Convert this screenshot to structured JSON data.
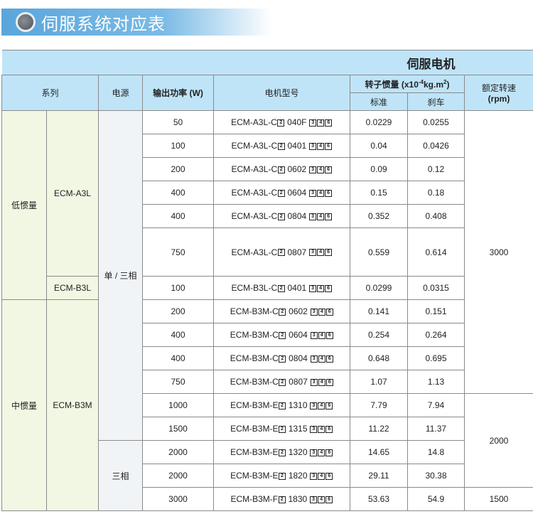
{
  "banner": {
    "title": "伺服系统对应表"
  },
  "header": {
    "group": "伺服电机",
    "series": "系列",
    "power_source": "电源",
    "output": "输出功率 (W)",
    "model": "电机型号",
    "inertia": "转子惯量 (x10",
    "inertia_exp": "-4",
    "inertia_unit": "kg.m",
    "inertia_sq": "2",
    "inertia_close": ")",
    "standard": "标准",
    "brake": "刹车",
    "speed": "额定转速",
    "speed_unit": "(rpm)"
  },
  "groups": {
    "low": "低惯量",
    "mid": "中惯量",
    "a3l": "ECM-A3L",
    "b3l": "ECM-B3L",
    "b3m": "ECM-B3M",
    "single_three": "单 / 三相",
    "three": "三相",
    "s3000": "3000",
    "s2000": "2000",
    "s1500": "1500"
  },
  "rows": [
    {
      "w": "50",
      "pre": "ECM-A3L-C",
      "b1": "2",
      "code": "040F",
      "b2": [
        "3",
        "4",
        "6"
      ],
      "std": "0.0229",
      "brk": "0.0255"
    },
    {
      "w": "100",
      "pre": "ECM-A3L-C",
      "b1": "2",
      "code": "0401",
      "b2": [
        "3",
        "4",
        "6"
      ],
      "std": "0.04",
      "brk": "0.0426"
    },
    {
      "w": "200",
      "pre": "ECM-A3L-C",
      "b1": "2",
      "code": "0602",
      "b2": [
        "3",
        "4",
        "6"
      ],
      "std": "0.09",
      "brk": "0.12"
    },
    {
      "w": "400",
      "pre": "ECM-A3L-C",
      "b1": "2",
      "code": "0604",
      "b2": [
        "3",
        "4",
        "6"
      ],
      "std": "0.15",
      "brk": "0.18"
    },
    {
      "w": "400",
      "pre": "ECM-A3L-C",
      "b1": "2",
      "code": "0804",
      "b2": [
        "3",
        "4",
        "6"
      ],
      "std": "0.352",
      "brk": "0.408"
    },
    {
      "w": "750",
      "pre": "ECM-A3L-C",
      "b1": "2",
      "code": "0807",
      "b2": [
        "3",
        "4",
        "6"
      ],
      "std": "0.559",
      "brk": "0.614"
    },
    {
      "w": "100",
      "pre": "ECM-B3L-C",
      "b1": "2",
      "code": "0401",
      "b2": [
        "3",
        "4",
        "6"
      ],
      "std": "0.0299",
      "brk": "0.0315"
    },
    {
      "w": "200",
      "pre": "ECM-B3M-C",
      "b1": "2",
      "code": "0602",
      "b2": [
        "3",
        "4",
        "6"
      ],
      "std": "0.141",
      "brk": "0.151"
    },
    {
      "w": "400",
      "pre": "ECM-B3M-C",
      "b1": "2",
      "code": "0604",
      "b2": [
        "3",
        "4",
        "6"
      ],
      "std": "0.254",
      "brk": "0.264"
    },
    {
      "w": "400",
      "pre": "ECM-B3M-C",
      "b1": "2",
      "code": "0804",
      "b2": [
        "3",
        "4",
        "6"
      ],
      "std": "0.648",
      "brk": "0.695"
    },
    {
      "w": "750",
      "pre": "ECM-B3M-C",
      "b1": "2",
      "code": "0807",
      "b2": [
        "3",
        "4",
        "6"
      ],
      "std": "1.07",
      "brk": "1.13"
    },
    {
      "w": "1000",
      "pre": "ECM-B3M-E",
      "b1": "2",
      "code": "1310",
      "b2": [
        "3",
        "4",
        "6"
      ],
      "std": "7.79",
      "brk": "7.94"
    },
    {
      "w": "1500",
      "pre": "ECM-B3M-E",
      "b1": "2",
      "code": "1315",
      "b2": [
        "3",
        "4",
        "6"
      ],
      "std": "11.22",
      "brk": "11.37"
    },
    {
      "w": "2000",
      "pre": "ECM-B3M-E",
      "b1": "2",
      "code": "1320",
      "b2": [
        "3",
        "4",
        "6"
      ],
      "std": "14.65",
      "brk": "14.8"
    },
    {
      "w": "2000",
      "pre": "ECM-B3M-E",
      "b1": "2",
      "code": "1820",
      "b2": [
        "3",
        "4",
        "6"
      ],
      "std": "29.11",
      "brk": "30.38"
    },
    {
      "w": "3000",
      "pre": "ECM-B3M-F",
      "b1": "2",
      "code": "1830",
      "b2": [
        "3",
        "4",
        "6"
      ],
      "std": "53.63",
      "brk": "54.9"
    }
  ]
}
